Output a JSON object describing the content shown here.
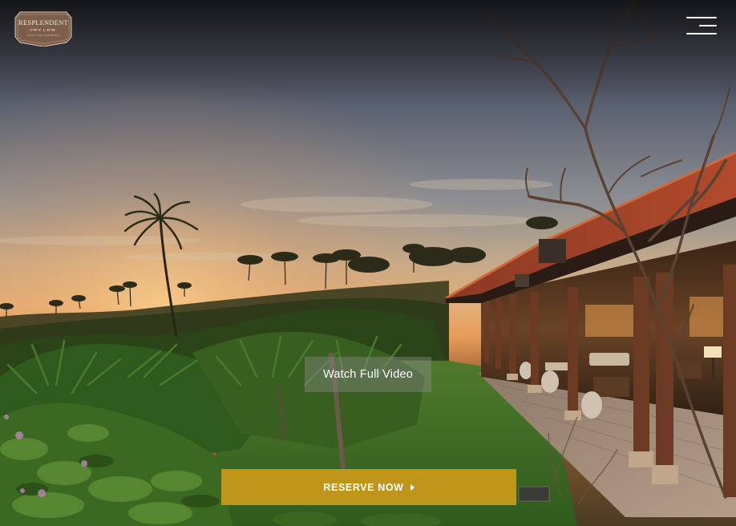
{
  "brand": {
    "name": "RESPLENDENT",
    "sub": "CEYLON",
    "tagline": "SOLAS YOUR OWN WORLD"
  },
  "header": {
    "menu_icon": "hamburger-menu-icon"
  },
  "hero": {
    "video_label": "Watch Full Video",
    "reserve_label": "RESERVE NOW",
    "reserve_icon": "caret-right-icon"
  },
  "colors": {
    "accent": "#c0961a",
    "logo_bg": "#7c5e4a",
    "video_button_bg": "rgba(140,140,140,0.42)"
  }
}
